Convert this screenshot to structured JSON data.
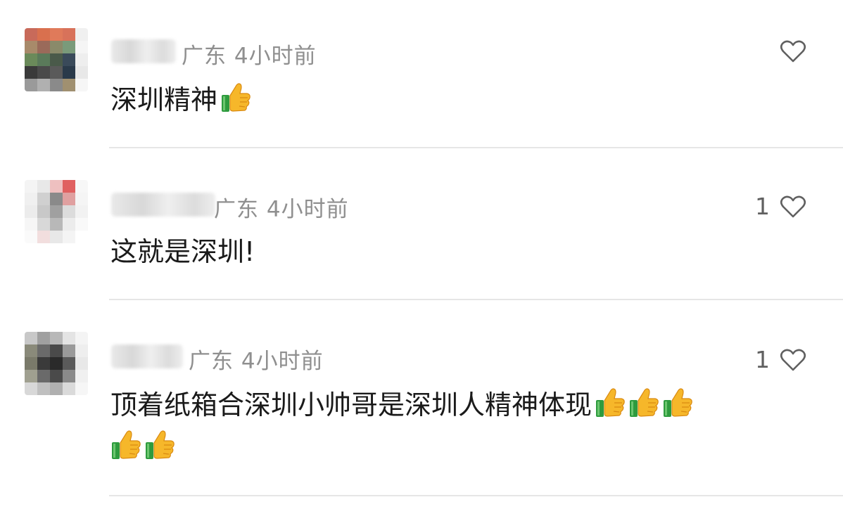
{
  "comments": [
    {
      "location": "广东",
      "time": "4小时前",
      "text": "深圳精神",
      "likes": "",
      "emoji": "thumbs-up"
    },
    {
      "location": "广东",
      "time": "4小时前",
      "text": "这就是深圳!",
      "likes": "1"
    },
    {
      "location": "广东",
      "time": "4小时前",
      "text": "顶着纸箱合深圳小帅哥是深圳人精神体现",
      "likes": "1",
      "emoji": "thumbs-up"
    }
  ],
  "colors": {
    "meta": "#8f8f8f",
    "text": "#1a1a1a",
    "divider": "#e6e6e6"
  }
}
